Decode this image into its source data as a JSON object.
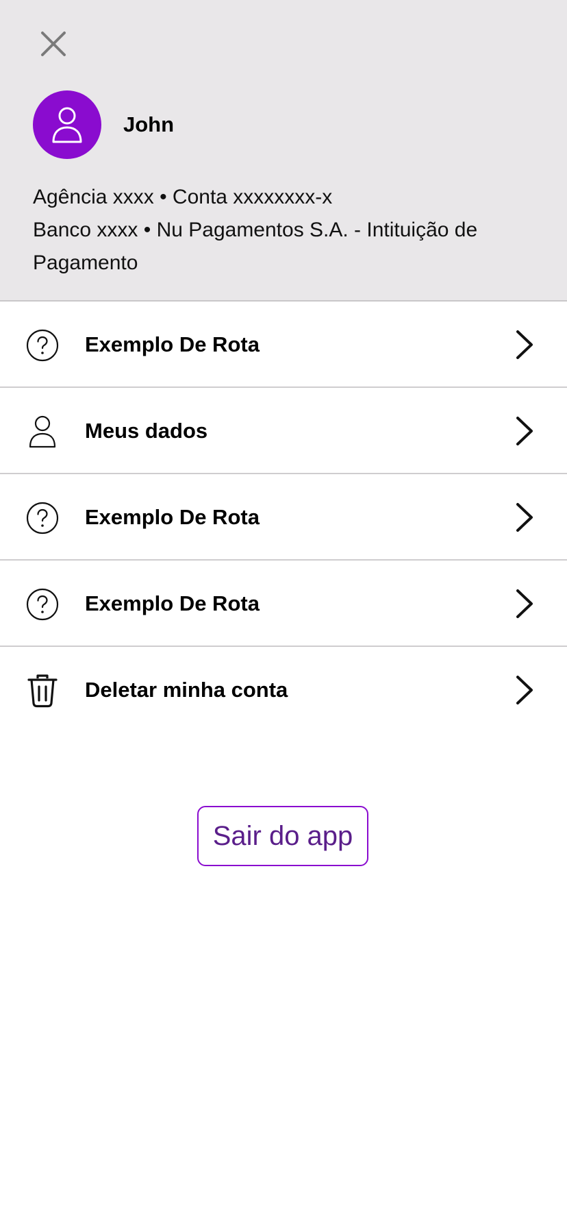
{
  "header": {
    "user_name": "John",
    "account_line_1": "Agência xxxx • Conta xxxxxxxx-x",
    "account_line_2": "Banco xxxx • Nu Pagamentos S.A. - Intituição de Pagamento",
    "avatar_color": "#8a0ccf",
    "background_color": "#e9e7e9"
  },
  "menu": {
    "items": [
      {
        "label": "Exemplo De Rota",
        "icon": "help-circle-icon"
      },
      {
        "label": "Meus dados",
        "icon": "user-icon"
      },
      {
        "label": "Exemplo De Rota",
        "icon": "help-circle-icon"
      },
      {
        "label": "Exemplo De Rota",
        "icon": "help-circle-icon"
      },
      {
        "label": "Deletar minha conta",
        "icon": "trash-icon"
      }
    ]
  },
  "logout": {
    "label": "Sair do app",
    "border_color": "#8a0ccf",
    "text_color": "#5a1e8a"
  }
}
